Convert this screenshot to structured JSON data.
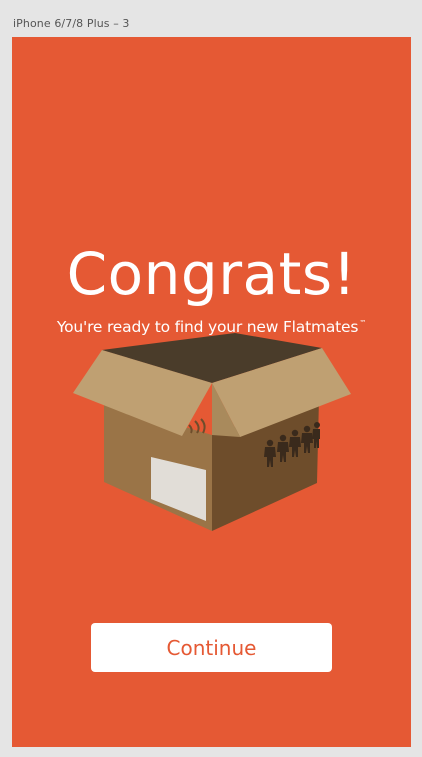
{
  "artboard": {
    "label": "iPhone 6/7/8 Plus – 3",
    "background_color": "#e55934"
  },
  "screen": {
    "title": "Congrats!",
    "subtitle": "You're ready to find your new Flatmates",
    "trademark": "™",
    "illustration": "open-cardboard-box-with-paper-people-icon"
  },
  "actions": {
    "continue_label": "Continue"
  },
  "colors": {
    "accent": "#e55934",
    "text_on_accent": "#ffffff",
    "button_bg": "#ffffff"
  }
}
